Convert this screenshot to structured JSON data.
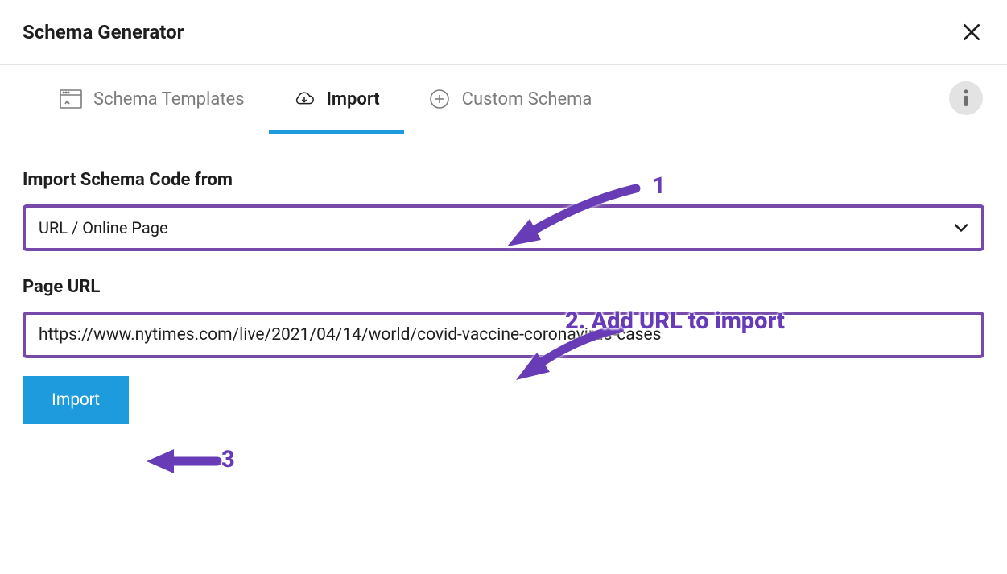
{
  "header": {
    "title": "Schema Generator"
  },
  "tabs": {
    "items": [
      {
        "label": "Schema Templates",
        "icon": "template",
        "active": false
      },
      {
        "label": "Import",
        "icon": "cloud-download",
        "active": true
      },
      {
        "label": "Custom Schema",
        "icon": "plus-circle",
        "active": false
      }
    ]
  },
  "main": {
    "sourceLabel": "Import Schema Code from",
    "sourceValue": "URL / Online Page",
    "urlLabel": "Page URL",
    "urlValue": "https://www.nytimes.com/live/2021/04/14/world/covid-vaccine-coronavirus-cases",
    "importButton": "Import"
  },
  "annotations": {
    "step1": "1",
    "step2": "2. Add URL to import",
    "step3": "3",
    "color": "#673ab7"
  }
}
